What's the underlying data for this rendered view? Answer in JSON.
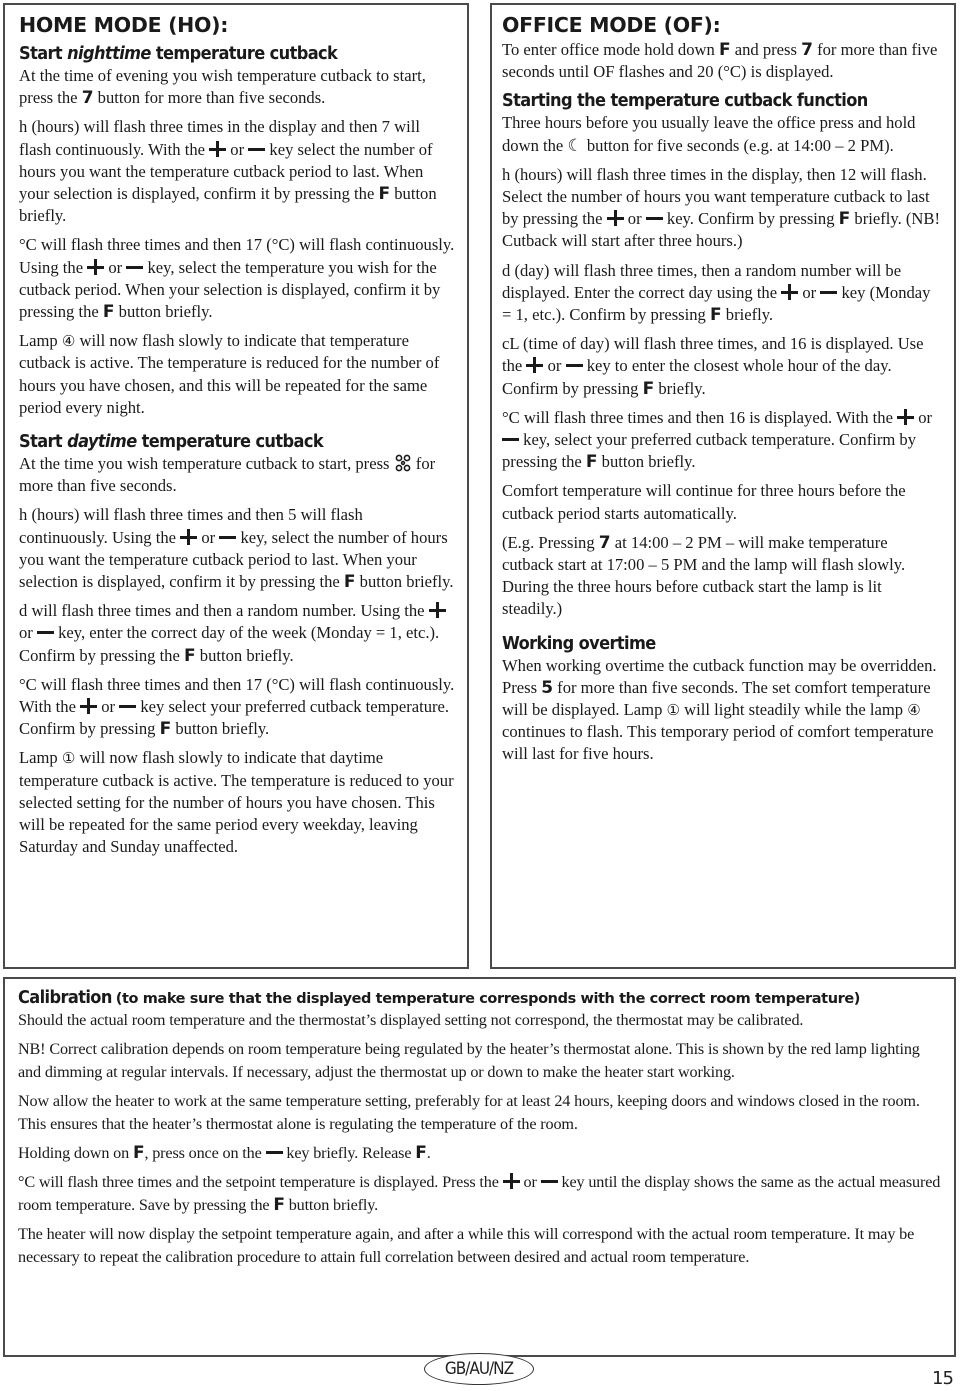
{
  "home_mode": {
    "title": "HOME MODE (HO):",
    "nighttime": {
      "heading_prefix": "Start",
      "heading_emphasis": "nighttime",
      "heading_suffix": "temperature cutback",
      "p1": {
        "a": "At the time of evening you wish temperature cutback to start, press the ",
        "key": "7",
        "b": " button for more than five seconds."
      },
      "p2": {
        "a": "h (hours) will flash three times in the display and then 7 will flash continuously. With the ",
        "b": " or ",
        "c": " key select the number of hours you want the temperature cutback period to last. When your selection is displayed, confirm it by pressing the ",
        "key": "F",
        "d": " button briefly."
      },
      "p3": {
        "a": "°C will flash three times and then 17 (°C) will flash continuously. Using the ",
        "b": " or ",
        "c": " key, select the temperature you wish for the cutback period. When your selection is displayed, confirm it by pressing the ",
        "key": "F",
        "d": " button briefly."
      },
      "p4": {
        "a": "Lamp ",
        "lamp": "④",
        "b": " will now flash slowly to indicate that temperature cutback is active. The temperature is reduced for the number of hours you have chosen, and this will be repeated for the same period every night."
      }
    },
    "daytime": {
      "heading_prefix": "Start",
      "heading_emphasis": "daytime",
      "heading_suffix": "temperature cutback",
      "p1": {
        "a": "At the time you wish temperature cutback to start, press ",
        "icon": "fan-icon",
        "b": " for more than five seconds."
      },
      "p2": {
        "a": "h (hours) will flash three times and then 5 will flash continuously. Using the ",
        "b": " or ",
        "c": " key, select the number of hours you want the temperature cutback period to last. When your selection is displayed, confirm it by pressing the ",
        "key": "F",
        "d": " button briefly."
      },
      "p3": {
        "a": "d will flash three times and then a random number. Using the ",
        "b": " or ",
        "c": " key, enter the correct day of the week (Monday = 1, etc.). Confirm by pressing the ",
        "key": "F",
        "d": " button briefly."
      },
      "p4": {
        "a": "°C will flash three times and then 17 (°C) will flash continuously. With the ",
        "b": " or ",
        "c": " key select your preferred cutback temperature. Confirm by pressing ",
        "key": "F",
        "d": " button briefly."
      },
      "p5": {
        "a": "Lamp ",
        "lamp": "①",
        "b": " will now flash slowly to indicate that daytime temperature cutback is active. The temperature is reduced to your selected setting for the number of hours you have chosen. This will be repeated for the same period every weekday, leaving Saturday and Sunday unaffected."
      }
    }
  },
  "office_mode": {
    "title": "OFFICE MODE (OF):",
    "intro": {
      "a": "To enter office mode hold down ",
      "key1": "F",
      "b": " and press ",
      "key2": "7",
      "c": " for more than five seconds until OF flashes and 20 (°C) is displayed."
    },
    "starting": {
      "heading": "Starting the temperature cutback function",
      "p1": {
        "a": "Three hours before you usually leave the office press and hold down the ",
        "icon": "☾",
        "b": " button for five seconds (e.g. at 14:00 – 2 PM)."
      },
      "p2": {
        "a": "h (hours) will flash three times in the display, then 12 will flash. Select the number of hours you want temperature cutback to last by pressing the ",
        "b": " or ",
        "c": " key. Confirm by pressing ",
        "key": "F",
        "d": " briefly. (NB! Cutback will start after three hours.)"
      },
      "p3": {
        "a": "d (day) will flash three times, then a random number will be displayed. Enter the correct day using the ",
        "b": " or ",
        "c": " key (Monday = 1, etc.). Confirm by pressing ",
        "key": "F",
        "d": " briefly."
      },
      "p4": {
        "a": "cL (time of day) will flash three times, and 16 is displayed. Use the ",
        "b": " or ",
        "c": " key to enter the closest whole hour of the day. Confirm by pressing ",
        "key": "F",
        "d": " briefly."
      },
      "p5": {
        "a": "°C will flash three times and then 16 is displayed. With the ",
        "b": " or ",
        "c": " key, select your preferred cutback temperature. Confirm by pressing the ",
        "key": "F",
        "d": " button briefly."
      },
      "p6": "Comfort temperature will continue for three hours before the cutback period starts automatically.",
      "p7": {
        "a": "(E.g. Pressing ",
        "key": "7",
        "b": " at 14:00 – 2 PM – will make temperature cutback start at 17:00 – 5 PM and the lamp will flash slowly. During the three hours before cutback start the lamp is lit steadily.)"
      }
    },
    "overtime": {
      "heading": "Working overtime",
      "p1": {
        "a": "When working overtime the cutback function may be overridden. Press ",
        "key": "5",
        "b": " for more than five seconds. The set comfort temperature will be displayed. Lamp ",
        "lamp1": "①",
        "c": " will light steadily while the lamp ",
        "lamp2": "④",
        "d": " continues to flash. This temporary period of comfort temperature will last for five hours."
      }
    }
  },
  "calibration": {
    "heading": "Calibration",
    "subheading": "(to make sure that the displayed temperature corresponds with the correct room temperature)",
    "p1": "Should the actual room temperature and the thermostat’s displayed setting not correspond, the thermostat may be calibrated.",
    "p2": "NB! Correct calibration depends on room temperature being regulated by the heater’s thermostat alone. This is shown by the red lamp lighting and dimming at regular intervals. If necessary, adjust the thermostat up or down to make the heater start working.",
    "p3": "Now allow the heater to work at the same temperature setting, preferably for at least 24 hours, keeping doors and windows closed in the room. This ensures that the heater’s thermostat alone is regulating the temperature of the room.",
    "p4": {
      "a": "Holding down on ",
      "key1": "F",
      "b": ", press once on the ",
      "c": " key briefly. Release ",
      "key2": "F",
      "d": "."
    },
    "p5": {
      "a": "°C will flash three times and the setpoint temperature is displayed. Press the ",
      "b": " or ",
      "c": " key until the display shows the same as the actual measured room temperature. Save by pressing the ",
      "key": "F",
      "d": " button briefly."
    },
    "p6": "The heater will now display the setpoint temperature again, and after a while this will correspond with the actual room temperature. It may be necessary to repeat the calibration procedure to attain full correlation between desired and actual room temperature."
  },
  "footer": {
    "region": "GB/AU/NZ",
    "page_number": "15"
  }
}
